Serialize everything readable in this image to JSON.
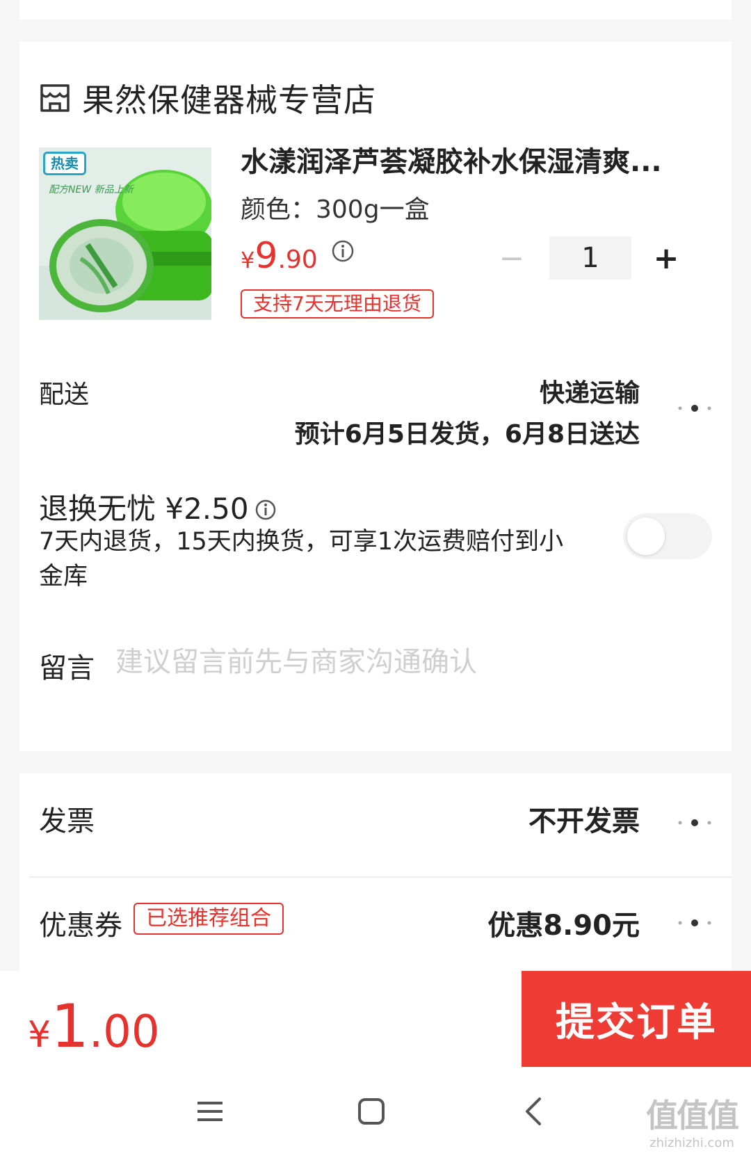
{
  "store": {
    "name": "果然保健器械专营店",
    "icon": "store-icon"
  },
  "product": {
    "title": "水漾润泽芦荟凝胶补水保湿清爽...",
    "spec": "颜色：300g一盒",
    "price_currency": "¥",
    "price_integer": "9",
    "price_decimal": ".90",
    "quantity": "1",
    "return_badge": "支持7天无理由退货",
    "image_tag": "热卖",
    "image_note": "配方NEW 新品上新"
  },
  "delivery": {
    "label": "配送",
    "method": "快递运输",
    "eta": "预计6月5日发货，6月8日送达"
  },
  "insurance": {
    "title": "退换无忧 ¥2.50",
    "description": "7天内退货，15天内换货，可享1次运费赔付到小金库",
    "enabled": false
  },
  "message": {
    "label": "留言",
    "placeholder": "建议留言前先与商家沟通确认"
  },
  "invoice": {
    "label": "发票",
    "value": "不开发票"
  },
  "coupon": {
    "label": "优惠券",
    "badge": "已选推荐组合",
    "value": "优惠8.90元"
  },
  "footer": {
    "total_currency": "¥",
    "total_integer": "1",
    "total_decimal": ".00",
    "submit_label": "提交订单"
  },
  "watermark": {
    "logo": "值值值",
    "url": "zhizhizhi.com"
  },
  "colors": {
    "accent": "#e5322d",
    "submit": "#ee3b33",
    "background": "#f6f6f6"
  }
}
